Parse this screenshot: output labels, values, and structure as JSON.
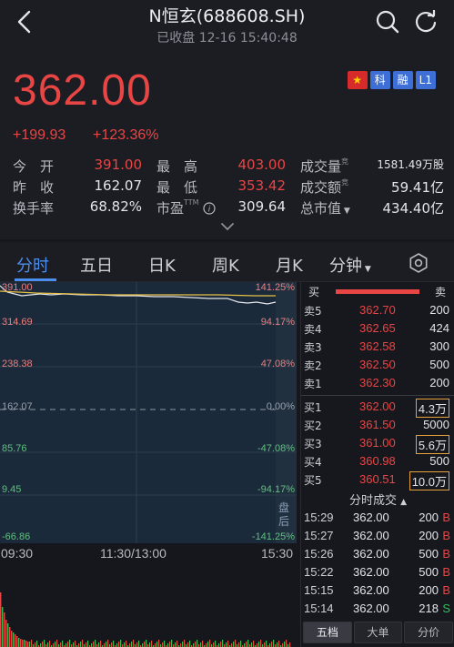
{
  "header": {
    "title": "N恒玄(688608.SH)",
    "subtitle": "已收盘 12-16 15:40:48"
  },
  "quote": {
    "price": "362.00",
    "change": "+199.93",
    "change_pct": "+123.36%",
    "badges": [
      "科",
      "融",
      "L1"
    ],
    "rows": [
      [
        {
          "label": "今　开",
          "value": "391.00",
          "color": "red"
        },
        {
          "label": "最　高",
          "value": "403.00",
          "color": "red"
        },
        {
          "label": "成交量",
          "value": "1581.49万股",
          "color": "white",
          "sup": "竞"
        }
      ],
      [
        {
          "label": "昨　收",
          "value": "162.07",
          "color": "white"
        },
        {
          "label": "最　低",
          "value": "353.42",
          "color": "red"
        },
        {
          "label": "成交额",
          "value": "59.41亿",
          "color": "white",
          "sup": "竞"
        }
      ],
      [
        {
          "label": "换手率",
          "value": "68.82%",
          "color": "white"
        },
        {
          "label": "市盈TTM",
          "value": "309.64",
          "color": "white"
        },
        {
          "label": "总市值",
          "value": "434.40亿",
          "color": "white"
        }
      ]
    ]
  },
  "tabs": [
    "分时",
    "五日",
    "日K",
    "周K",
    "月K",
    "分钟"
  ],
  "chart": {
    "left_axis": [
      {
        "text": "391.00",
        "color": "red"
      },
      {
        "text": "314.69",
        "color": "red"
      },
      {
        "text": "238.38",
        "color": "red"
      },
      {
        "text": "162.07",
        "color": "white"
      },
      {
        "text": "85.76",
        "color": "grn"
      },
      {
        "text": "9.45",
        "color": "grn"
      },
      {
        "text": "-66.86",
        "color": "grn"
      }
    ],
    "right_axis": [
      {
        "text": "141.25%",
        "color": "red"
      },
      {
        "text": "94.17%",
        "color": "red"
      },
      {
        "text": "47.08%",
        "color": "red"
      },
      {
        "text": "0.00%",
        "color": "white"
      },
      {
        "text": "-47.08%",
        "color": "grn"
      },
      {
        "text": "-94.17%",
        "color": "grn"
      },
      {
        "text": "-141.25%",
        "color": "grn"
      }
    ],
    "time_labels": [
      "09:30",
      "11:30/13:00",
      "15:30"
    ],
    "after_hours": "盘后"
  },
  "book": {
    "buy_label": "买",
    "sell_label": "卖",
    "asks": [
      {
        "label": "卖5",
        "price": "362.70",
        "vol": "200"
      },
      {
        "label": "卖4",
        "price": "362.65",
        "vol": "424"
      },
      {
        "label": "卖3",
        "price": "362.58",
        "vol": "300"
      },
      {
        "label": "卖2",
        "price": "362.50",
        "vol": "500"
      },
      {
        "label": "卖1",
        "price": "362.30",
        "vol": "200"
      }
    ],
    "bids": [
      {
        "label": "买1",
        "price": "362.00",
        "vol": "4.3万",
        "boxed": true
      },
      {
        "label": "买2",
        "price": "361.50",
        "vol": "5000",
        "boxed": false
      },
      {
        "label": "买3",
        "price": "361.00",
        "vol": "5.6万",
        "boxed": true
      },
      {
        "label": "买4",
        "price": "360.98",
        "vol": "500",
        "boxed": false
      },
      {
        "label": "买5",
        "price": "360.51",
        "vol": "10.0万",
        "boxed": true
      }
    ],
    "trades_title": "分时成交",
    "trades": [
      {
        "time": "15:29",
        "price": "362.00",
        "vol": "200",
        "dir": "B"
      },
      {
        "time": "15:27",
        "price": "362.00",
        "vol": "200",
        "dir": "B"
      },
      {
        "time": "15:26",
        "price": "362.00",
        "vol": "500",
        "dir": "B"
      },
      {
        "time": "15:22",
        "price": "362.00",
        "vol": "500",
        "dir": "B"
      },
      {
        "time": "15:15",
        "price": "362.00",
        "vol": "200",
        "dir": "B"
      },
      {
        "time": "15:14",
        "price": "362.00",
        "vol": "218",
        "dir": "S"
      }
    ],
    "bottom_tabs": [
      "五档",
      "大单",
      "分价"
    ]
  },
  "colors": {
    "up": "#e84545",
    "down": "#2fbf5a",
    "accent": "#4a8ff0"
  }
}
